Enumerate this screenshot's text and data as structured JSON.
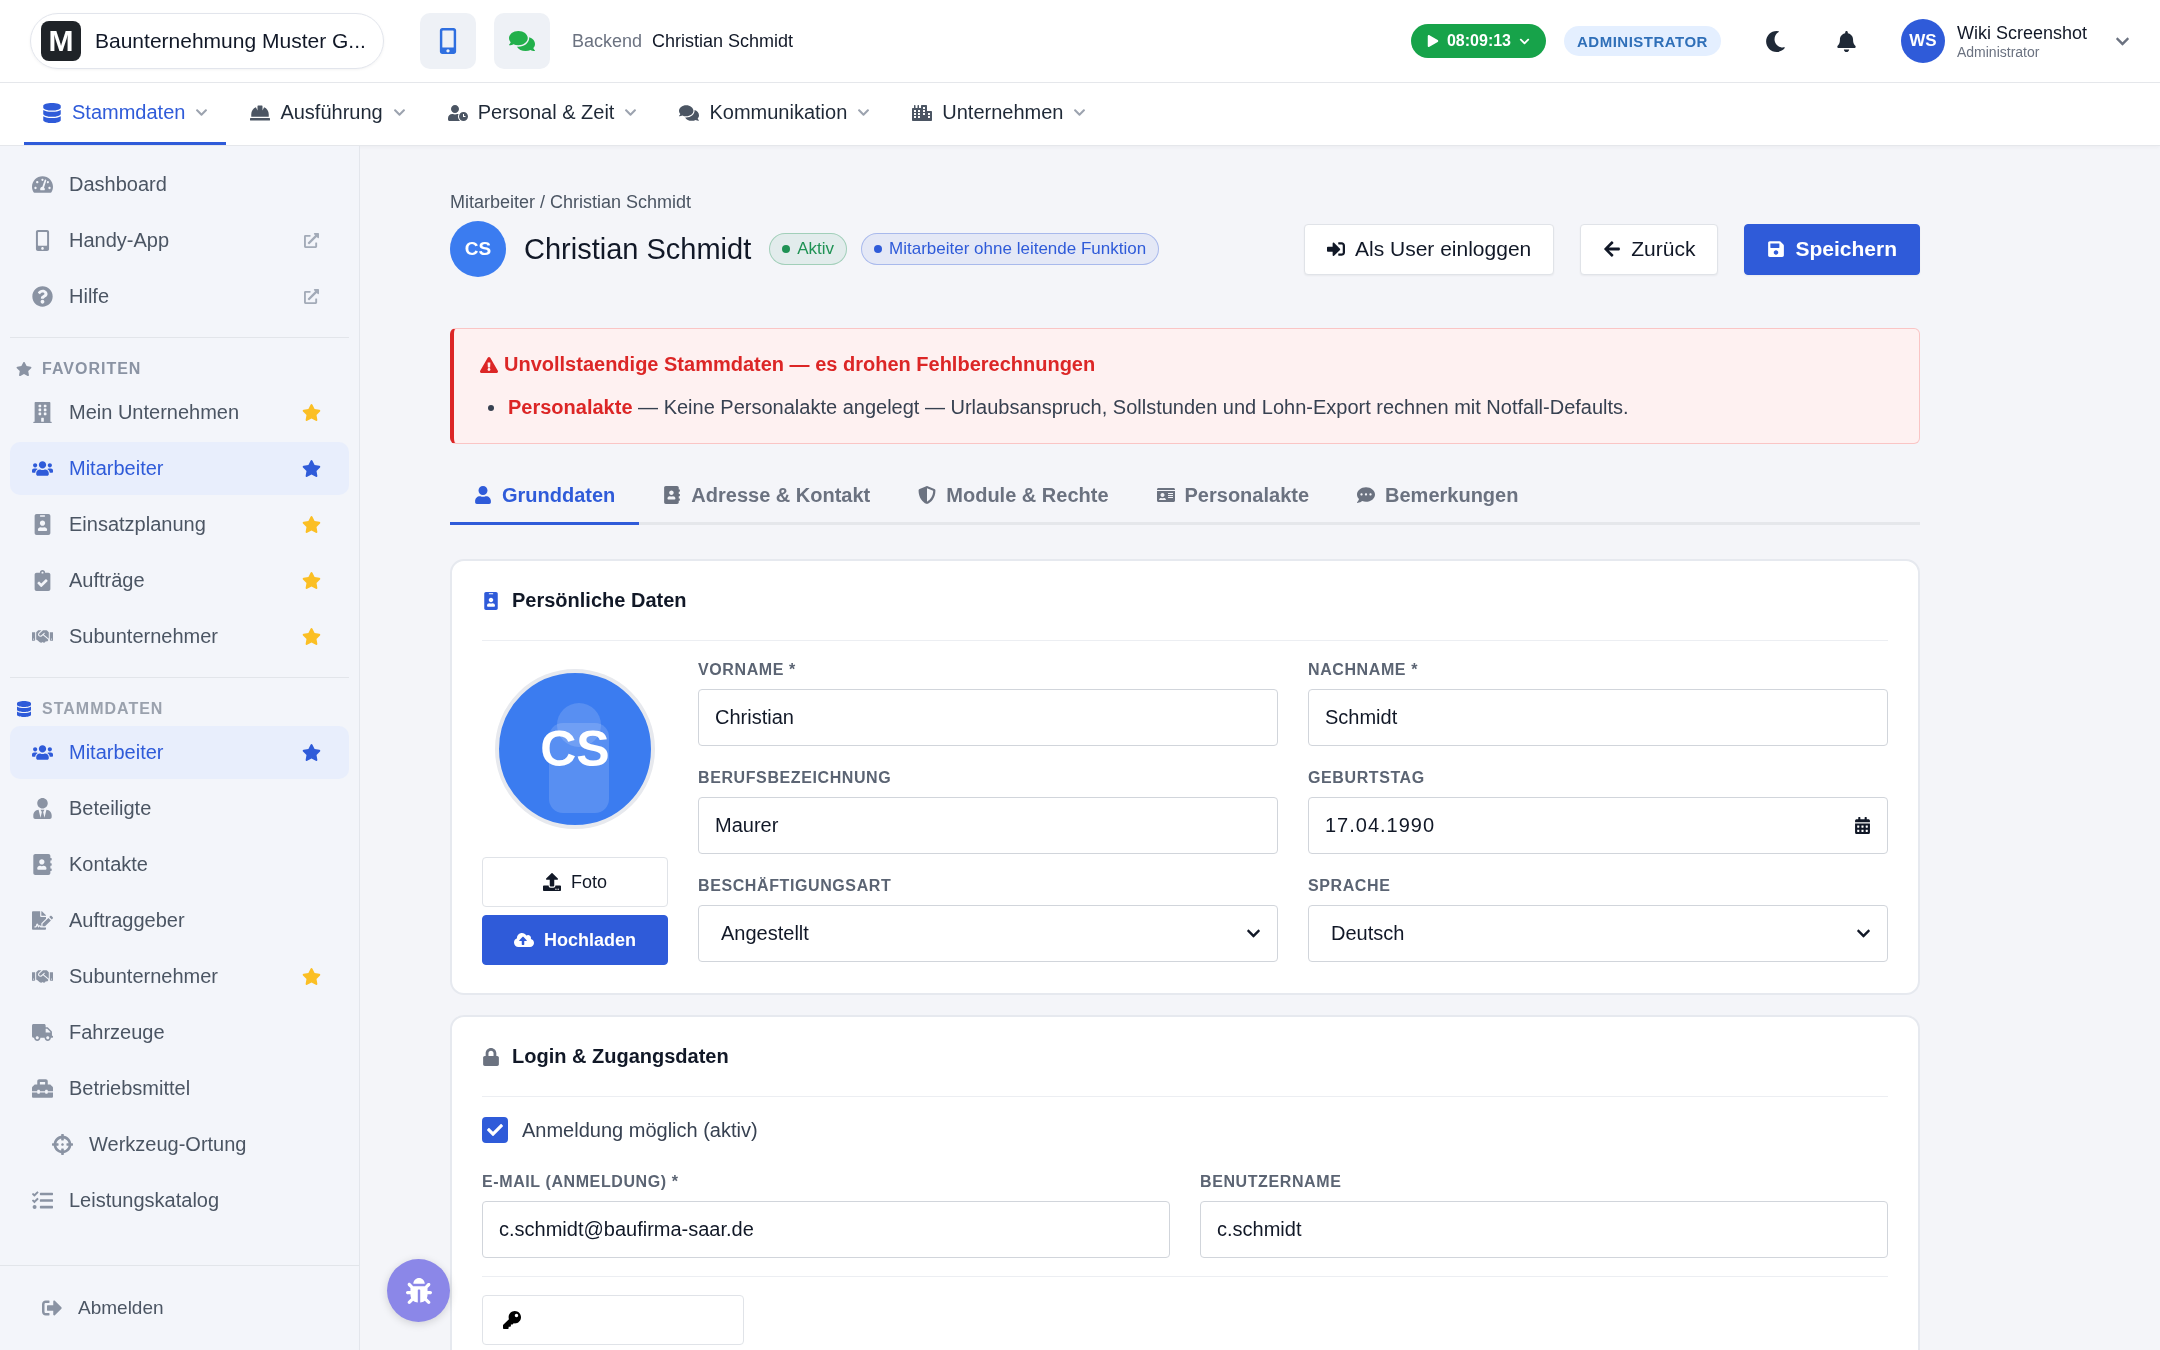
{
  "topbar": {
    "logo_letter": "M",
    "company": "Baunternehmung Muster G...",
    "context_label": "Backend",
    "context_user": "Christian Schmidt",
    "timer": "08:09:13",
    "role": "ADMINISTRATOR",
    "user": {
      "initials": "WS",
      "name": "Wiki Screenshot",
      "role": "Administrator"
    }
  },
  "nav": [
    {
      "label": "Stammdaten",
      "selected": true
    },
    {
      "label": "Ausführung",
      "selected": false
    },
    {
      "label": "Personal & Zeit",
      "selected": false
    },
    {
      "label": "Kommunikation",
      "selected": false
    },
    {
      "label": "Unternehmen",
      "selected": false
    }
  ],
  "sidebar": {
    "top": [
      {
        "label": "Dashboard",
        "external": false
      },
      {
        "label": "Handy-App",
        "external": true
      },
      {
        "label": "Hilfe",
        "external": true
      }
    ],
    "sections": [
      {
        "title": "FAVORITEN",
        "items": [
          {
            "label": "Mein Unternehmen",
            "selected": false,
            "favorite": true
          },
          {
            "label": "Mitarbeiter",
            "selected": true,
            "favorite": true
          },
          {
            "label": "Einsatzplanung",
            "selected": false,
            "favorite": true
          },
          {
            "label": "Aufträge",
            "selected": false,
            "favorite": true
          },
          {
            "label": "Subunternehmer",
            "selected": false,
            "favorite": true
          }
        ]
      },
      {
        "title": "STAMMDATEN",
        "items": [
          {
            "label": "Mitarbeiter",
            "selected": true,
            "favorite": true
          },
          {
            "label": "Beteiligte",
            "selected": false,
            "favorite": false
          },
          {
            "label": "Kontakte",
            "selected": false,
            "favorite": false
          },
          {
            "label": "Auftraggeber",
            "selected": false,
            "favorite": false
          },
          {
            "label": "Subunternehmer",
            "selected": false,
            "favorite": true
          },
          {
            "label": "Fahrzeuge",
            "selected": false,
            "favorite": false
          },
          {
            "label": "Betriebsmittel",
            "selected": false,
            "favorite": false,
            "children": [
              {
                "label": "Werkzeug-Ortung",
                "selected": false,
                "favorite": false
              }
            ]
          },
          {
            "label": "Leistungskatalog",
            "selected": false,
            "favorite": false
          }
        ]
      }
    ],
    "footer": "Abmelden"
  },
  "page": {
    "breadcrumb": "Mitarbeiter / Christian Schmidt",
    "initials": "CS",
    "title": "Christian Schmidt",
    "badges": [
      {
        "label": "Aktiv",
        "color": "#1f9254"
      },
      {
        "label": "Mitarbeiter ohne leitende Funktion",
        "color": "#2f5bd9"
      }
    ],
    "buttons": [
      {
        "label": "Als User einloggen",
        "kind": "login"
      },
      {
        "label": "Zurück",
        "kind": "back"
      },
      {
        "label": "Speichern",
        "kind": "save"
      }
    ],
    "alert": {
      "title": "Unvollstaendige Stammdaten — es drohen Fehlberechnungen",
      "items": [
        {
          "term": "Personalakte",
          "text": "— Keine Personalakte angelegt — Urlaubsanspruch, Sollstunden und Lohn-Export rechnen mit Notfall-Defaults."
        }
      ]
    },
    "tabs": [
      {
        "label": "Grunddaten",
        "selected": true
      },
      {
        "label": "Adresse & Kontakt",
        "selected": false
      },
      {
        "label": "Module & Rechte",
        "selected": false
      },
      {
        "label": "Personalakte",
        "selected": false
      },
      {
        "label": "Bemerkungen",
        "selected": false
      }
    ],
    "personal": {
      "title": "Persönliche Daten",
      "initials": "CS",
      "photo_button": "Foto",
      "upload_button": "Hochladen",
      "fields": [
        {
          "label": "VORNAME *",
          "value": "Christian",
          "kind": "text"
        },
        {
          "label": "NACHNAME *",
          "value": "Schmidt",
          "kind": "text"
        },
        {
          "label": "BERUFSBEZEICHNUNG",
          "value": "Maurer",
          "kind": "text"
        },
        {
          "label": "GEBURTSTAG",
          "value": "17.04.1990",
          "kind": "date"
        },
        {
          "label": "BESCHÄFTIGUNGSART",
          "value": "Angestellt",
          "kind": "select"
        },
        {
          "label": "SPRACHE",
          "value": "Deutsch",
          "kind": "select"
        }
      ]
    },
    "login": {
      "title": "Login & Zugangsdaten",
      "checkbox": {
        "label": "Anmeldung möglich (aktiv)",
        "checked": true
      },
      "fields": [
        {
          "label": "E-MAIL (ANMELDUNG) *",
          "value": "c.schmidt@baufirma-saar.de"
        },
        {
          "label": "BENUTZERNAME",
          "value": "c.schmidt"
        }
      ]
    }
  }
}
